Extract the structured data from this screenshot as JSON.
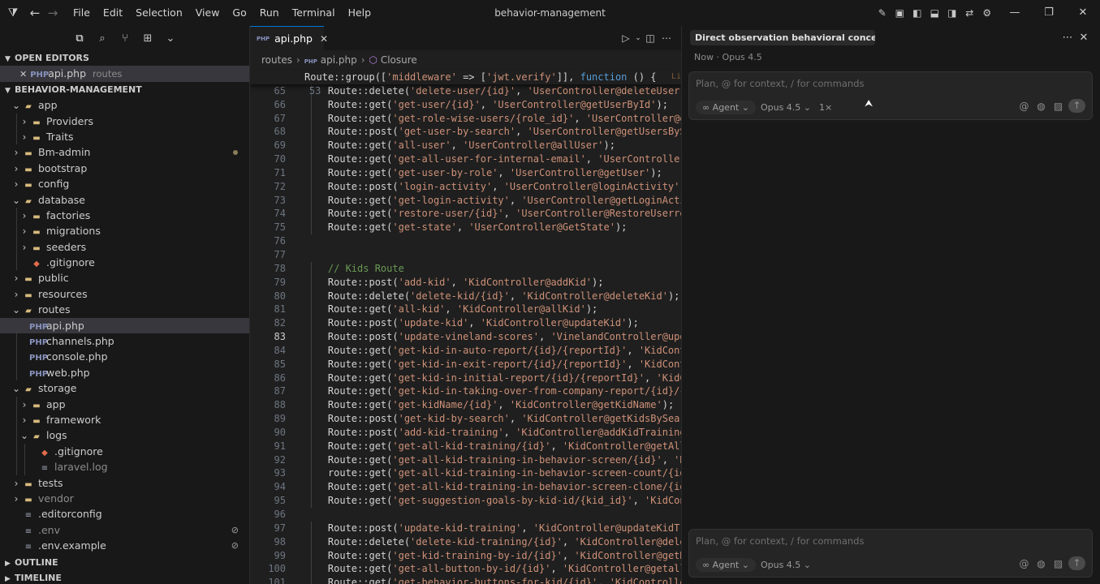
{
  "window": {
    "title": "behavior-management",
    "menu": [
      "File",
      "Edit",
      "Selection",
      "View",
      "Go",
      "Run",
      "Terminal",
      "Help"
    ]
  },
  "sidebar": {
    "open_editors_header": "OPEN EDITORS",
    "open_editor": {
      "name": "api.php",
      "path": "routes"
    },
    "project_header": "BEHAVIOR-MANAGEMENT",
    "tree": [
      {
        "label": "app",
        "depth": 0,
        "type": "folder",
        "open": true
      },
      {
        "label": "Providers",
        "depth": 1,
        "type": "folder"
      },
      {
        "label": "Traits",
        "depth": 1,
        "type": "folder"
      },
      {
        "label": "Bm-admin",
        "depth": 0,
        "type": "folder",
        "dot": true
      },
      {
        "label": "bootstrap",
        "depth": 0,
        "type": "folder"
      },
      {
        "label": "config",
        "depth": 0,
        "type": "folder"
      },
      {
        "label": "database",
        "depth": 0,
        "type": "folder",
        "open": true
      },
      {
        "label": "factories",
        "depth": 1,
        "type": "folder"
      },
      {
        "label": "migrations",
        "depth": 1,
        "type": "folder"
      },
      {
        "label": "seeders",
        "depth": 1,
        "type": "folder"
      },
      {
        "label": ".gitignore",
        "depth": 1,
        "type": "git"
      },
      {
        "label": "public",
        "depth": 0,
        "type": "folder"
      },
      {
        "label": "resources",
        "depth": 0,
        "type": "folder"
      },
      {
        "label": "routes",
        "depth": 0,
        "type": "folder",
        "open": true
      },
      {
        "label": "api.php",
        "depth": 1,
        "type": "php",
        "selected": true
      },
      {
        "label": "channels.php",
        "depth": 1,
        "type": "php"
      },
      {
        "label": "console.php",
        "depth": 1,
        "type": "php"
      },
      {
        "label": "web.php",
        "depth": 1,
        "type": "php"
      },
      {
        "label": "storage",
        "depth": 0,
        "type": "folder",
        "open": true
      },
      {
        "label": "app",
        "depth": 1,
        "type": "folder"
      },
      {
        "label": "framework",
        "depth": 1,
        "type": "folder"
      },
      {
        "label": "logs",
        "depth": 1,
        "type": "folder",
        "open": true
      },
      {
        "label": ".gitignore",
        "depth": 2,
        "type": "git"
      },
      {
        "label": "laravel.log",
        "depth": 2,
        "type": "plain",
        "dim": true
      },
      {
        "label": "tests",
        "depth": 0,
        "type": "folder"
      },
      {
        "label": "vendor",
        "depth": 0,
        "type": "folder",
        "dim": true
      },
      {
        "label": ".editorconfig",
        "depth": 0,
        "type": "plain"
      },
      {
        "label": ".env",
        "depth": 0,
        "type": "plain",
        "dim": true,
        "badge": "⊘"
      },
      {
        "label": ".env.example",
        "depth": 0,
        "type": "plain",
        "badge": "⊘"
      }
    ],
    "outline_header": "OUTLINE",
    "timeline_header": "TIMELINE"
  },
  "editor": {
    "tab": "api.php",
    "breadcrumbs": [
      "routes",
      "api.php",
      "Closure"
    ],
    "sticky_line": {
      "n": "53",
      "text": "Route::group(['middleware' => ['jwt.verify']], function () {"
    },
    "ghost_text": "Li",
    "lines": [
      {
        "n": "65",
        "text": "    Route::delete('delete-user/{id}', 'UserController@deleteUser');"
      },
      {
        "n": "66",
        "text": "    Route::get('get-user/{id}', 'UserController@getUserById');"
      },
      {
        "n": "67",
        "text": "    Route::get('get-role-wise-users/{role_id}', 'UserController@getU"
      },
      {
        "n": "68",
        "text": "    Route::post('get-user-by-search', 'UserController@getUsersBySear"
      },
      {
        "n": "69",
        "text": "    Route::get('all-user', 'UserController@allUser');"
      },
      {
        "n": "70",
        "text": "    Route::get('get-all-user-for-internal-email', 'UserController@get"
      },
      {
        "n": "71",
        "text": "    Route::get('get-user-by-role', 'UserController@getUser');"
      },
      {
        "n": "72",
        "text": "    Route::post('login-activity', 'UserController@loginActivity');"
      },
      {
        "n": "73",
        "text": "    Route::get('get-login-activity', 'UserController@getLoginActivity"
      },
      {
        "n": "74",
        "text": "    Route::get('restore-user/{id}', 'UserController@RestoreUserrecor"
      },
      {
        "n": "75",
        "text": "    Route::get('get-state', 'UserController@GetState');"
      },
      {
        "n": "76",
        "text": ""
      },
      {
        "n": "77",
        "text": ""
      },
      {
        "n": "78",
        "text": "    // Kids Route"
      },
      {
        "n": "79",
        "text": "    Route::post('add-kid', 'KidController@addKid');"
      },
      {
        "n": "80",
        "text": "    Route::delete('delete-kid/{id}', 'KidController@deleteKid');"
      },
      {
        "n": "81",
        "text": "    Route::get('all-kid', 'KidController@allKid');"
      },
      {
        "n": "82",
        "text": "    Route::post('update-kid', 'KidController@updateKid');"
      },
      {
        "n": "83",
        "text": "    Route::post('update-vineland-scores', 'VinelandController@update"
      },
      {
        "n": "84",
        "text": "    Route::get('get-kid-in-auto-report/{id}/{reportId}', 'KidControll"
      },
      {
        "n": "85",
        "text": "    Route::get('get-kid-in-exit-report/{id}/{reportId}', 'KidControll"
      },
      {
        "n": "86",
        "text": "    Route::get('get-kid-in-initial-report/{id}/{reportId}', 'KidContr"
      },
      {
        "n": "87",
        "text": "    Route::get('get-kid-in-taking-over-from-company-report/{id}/{rep"
      },
      {
        "n": "88",
        "text": "    Route::get('get-kidName/{id}', 'KidController@getKidName');"
      },
      {
        "n": "89",
        "text": "    Route::post('get-kid-by-search', 'KidController@getKidsBySearch'"
      },
      {
        "n": "90",
        "text": "    Route::post('add-kid-training', 'KidController@addKidTraining');"
      },
      {
        "n": "91",
        "text": "    Route::get('get-all-kid-training/{id}', 'KidController@getAllKid"
      },
      {
        "n": "92",
        "text": "    Route::get('get-all-kid-training-in-behavior-screen/{id}', 'KidCo"
      },
      {
        "n": "93",
        "text": "    route::get('get-all-kid-training-in-behavior-screen-count/{id}',"
      },
      {
        "n": "94",
        "text": "    Route::get('get-all-kid-training-in-behavior-screen-clone/{id}',"
      },
      {
        "n": "95",
        "text": "    Route::get('get-suggestion-goals-by-kid-id/{kid_id}', 'KidContro"
      },
      {
        "n": "96",
        "text": ""
      },
      {
        "n": "97",
        "text": "    Route::post('update-kid-training', 'KidController@updateKidTrain"
      },
      {
        "n": "98",
        "text": "    Route::delete('delete-kid-training/{id}', 'KidController@deleteK"
      },
      {
        "n": "99",
        "text": "    Route::get('get-kid-training-by-id/{id}', 'KidController@getKidT"
      },
      {
        "n": "100",
        "text": "    Route::get('get-all-button-by-id/{id}', 'KidController@getallKid"
      },
      {
        "n": "101",
        "text": "    Route::get('get-behavior-buttons-for-kid/{id}', 'KidController@g"
      }
    ],
    "current_line": "83"
  },
  "chat": {
    "title": "Direct observation behavioral concerns savin",
    "meta": "Now · Opus 4.5",
    "top_composer": {
      "placeholder": "Plan, @ for context, / for commands",
      "mode": "Agent",
      "model": "Opus 4.5",
      "multiplier": "1×"
    },
    "bottom_composer": {
      "placeholder": "Plan, @ for context, / for commands",
      "mode": "Agent",
      "model": "Opus 4.5"
    }
  }
}
